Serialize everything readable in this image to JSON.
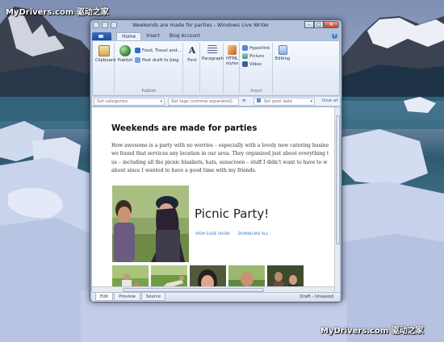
{
  "watermarks": {
    "top_left": "MyDrivers.com 驱动之家",
    "bottom_right": "MyDrivers.com 驱动之家"
  },
  "window": {
    "title": "Weekends are made for parties - Windows Live Writer",
    "tabs": [
      "Home",
      "Insert",
      "Blog Account"
    ],
    "active_tab": "Home",
    "help": "?"
  },
  "ribbon": {
    "clipboard": {
      "label": "Clipboard"
    },
    "publish_group": {
      "publish": "Publish",
      "blog_name": "Food, Travel and...",
      "post_draft": "Post draft to blog",
      "group_label": "Publish"
    },
    "font": {
      "label": "Font"
    },
    "paragraph": {
      "label": "Paragraph"
    },
    "html_styles": {
      "line1": "HTML",
      "line2": "styles"
    },
    "insert_group": {
      "hyperlink": "Hyperlink",
      "picture": "Picture",
      "video": "Video",
      "group_label": "Insert"
    },
    "editing": {
      "label": "Editing"
    }
  },
  "properties": {
    "categories_placeholder": "Set categories",
    "tags_placeholder": "Set tags (comma separated)",
    "date_placeholder": "Set post date",
    "view_all": "View all"
  },
  "post": {
    "title": "Weekends are made for parties",
    "body_lines": [
      "How awesome is a party with no worries – especially with a lovely new catering busine",
      "we found that services any location in our area. They organized just about everything t",
      "us – including all the picnic blankets, hats, sunscreen – stuff I didn’t want to have to w",
      "about since I wanted to have a good time with my friends."
    ],
    "album_title": "Picnic Party!",
    "album_links": [
      "VIEW SLIDE SHOW",
      "DOWNLOAD ALL"
    ]
  },
  "status": {
    "view_tabs": [
      "Edit",
      "Preview",
      "Source"
    ],
    "active_view": "Edit",
    "state": "Draft - Unsaved"
  },
  "colors": {
    "accent": "#2e6fbf",
    "ribbon_bg": "#eef3fb"
  }
}
